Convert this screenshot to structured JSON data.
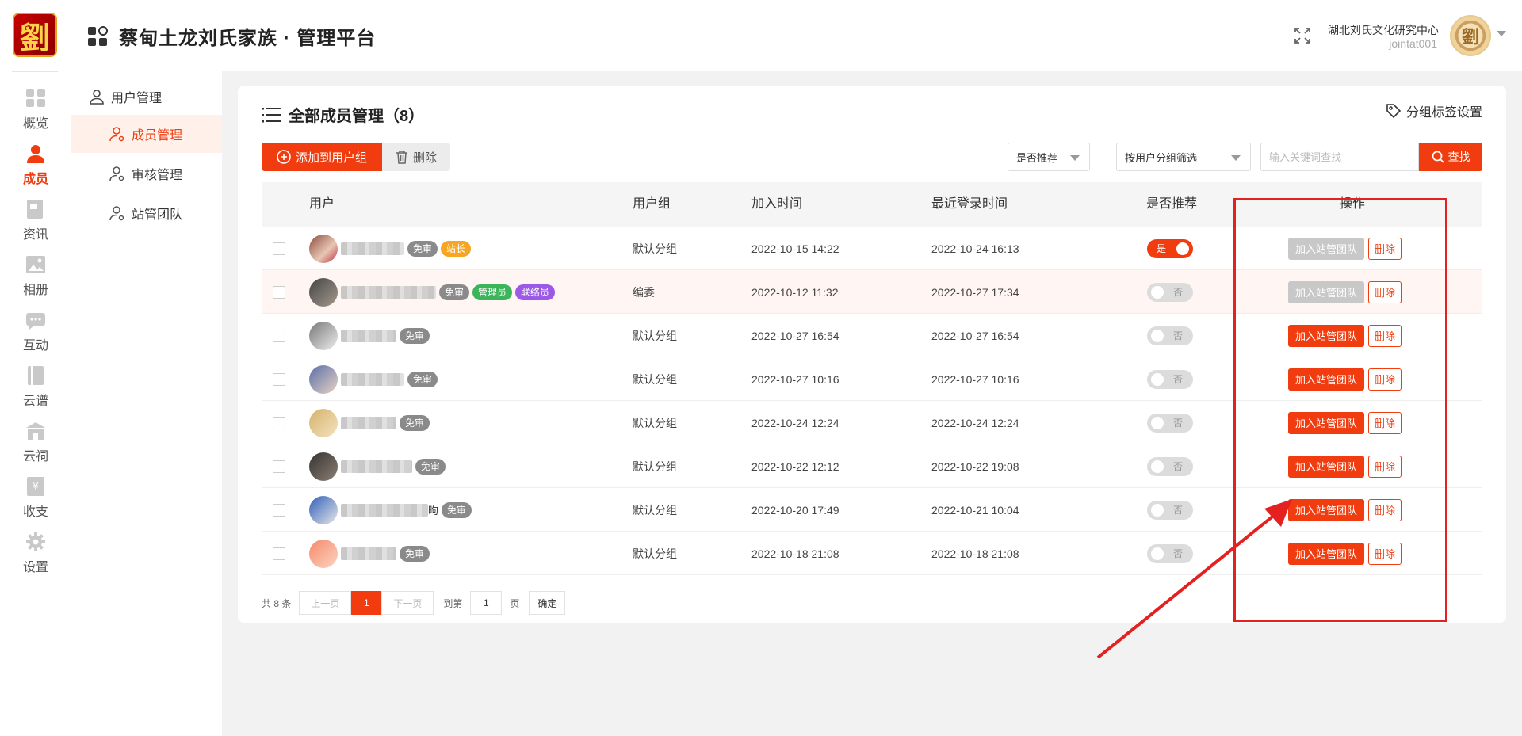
{
  "header": {
    "logo_text": "劉",
    "title": "蔡甸土龙刘氏家族 · 管理平台",
    "org_name": "湖北刘氏文化研究中心",
    "user_id": "jointat001",
    "avatar_text": "劉"
  },
  "rail": {
    "items": [
      {
        "label": "概览",
        "icon": "grid-icon"
      },
      {
        "label": "成员",
        "icon": "person-icon",
        "active": true
      },
      {
        "label": "资讯",
        "icon": "news-icon"
      },
      {
        "label": "相册",
        "icon": "photo-icon"
      },
      {
        "label": "互动",
        "icon": "chat-icon"
      },
      {
        "label": "云谱",
        "icon": "book-icon"
      },
      {
        "label": "云祠",
        "icon": "temple-icon"
      },
      {
        "label": "收支",
        "icon": "ledger-icon"
      },
      {
        "label": "设置",
        "icon": "gear-icon"
      }
    ]
  },
  "submenu": {
    "group": "用户管理",
    "items": [
      {
        "label": "成员管理",
        "active": true
      },
      {
        "label": "审核管理"
      },
      {
        "label": "站管团队"
      }
    ]
  },
  "main": {
    "title": "全部成员管理（8）",
    "tag_setting": "分组标签设置",
    "add_button": "添加到用户组",
    "delete_button": "删除",
    "filter_recommend": "是否推荐",
    "filter_group": "按用户分组筛选",
    "search_placeholder": "输入关键词查找",
    "search_button": "查找",
    "columns": [
      "用户",
      "用户组",
      "加入时间",
      "最近登录时间",
      "是否推荐",
      "操作"
    ],
    "rows": [
      {
        "group": "默认分组",
        "join": "2022-10-15 14:22",
        "login": "2022-10-24 16:13",
        "rec": "是",
        "rec_on": true,
        "badges": [
          "免审",
          "站长"
        ],
        "join_btn": "加入站管团队",
        "join_enabled": false,
        "remove": "删除",
        "name_suffix": ""
      },
      {
        "group": "编委",
        "join": "2022-10-12 11:32",
        "login": "2022-10-27 17:34",
        "rec": "否",
        "rec_on": false,
        "badges": [
          "免审",
          "管理员",
          "联络员"
        ],
        "join_btn": "加入站管团队",
        "join_enabled": false,
        "remove": "删除",
        "name_suffix": ""
      },
      {
        "group": "默认分组",
        "join": "2022-10-27 16:54",
        "login": "2022-10-27 16:54",
        "rec": "否",
        "rec_on": false,
        "badges": [
          "免审"
        ],
        "join_btn": "加入站管团队",
        "join_enabled": true,
        "remove": "删除",
        "name_suffix": ""
      },
      {
        "group": "默认分组",
        "join": "2022-10-27 10:16",
        "login": "2022-10-27 10:16",
        "rec": "否",
        "rec_on": false,
        "badges": [
          "免审"
        ],
        "join_btn": "加入站管团队",
        "join_enabled": true,
        "remove": "删除",
        "name_suffix": ""
      },
      {
        "group": "默认分组",
        "join": "2022-10-24 12:24",
        "login": "2022-10-24 12:24",
        "rec": "否",
        "rec_on": false,
        "badges": [
          "免审"
        ],
        "join_btn": "加入站管团队",
        "join_enabled": true,
        "remove": "删除",
        "name_suffix": ""
      },
      {
        "group": "默认分组",
        "join": "2022-10-22 12:12",
        "login": "2022-10-22 19:08",
        "rec": "否",
        "rec_on": false,
        "badges": [
          "免审"
        ],
        "join_btn": "加入站管团队",
        "join_enabled": true,
        "remove": "删除",
        "name_suffix": ""
      },
      {
        "group": "默认分组",
        "join": "2022-10-20 17:49",
        "login": "2022-10-21 10:04",
        "rec": "否",
        "rec_on": false,
        "badges": [
          "免审"
        ],
        "join_btn": "加入站管团队",
        "join_enabled": true,
        "remove": "删除",
        "name_suffix": "昫"
      },
      {
        "group": "默认分组",
        "join": "2022-10-18 21:08",
        "login": "2022-10-18 21:08",
        "rec": "否",
        "rec_on": false,
        "badges": [
          "免审"
        ],
        "join_btn": "加入站管团队",
        "join_enabled": true,
        "remove": "删除",
        "name_suffix": ""
      }
    ]
  },
  "pager": {
    "total": "共 8 条",
    "prev": "上一页",
    "current": "1",
    "next": "下一页",
    "goto": "到第",
    "page_input": "1",
    "page_unit": "页",
    "confirm": "确定"
  },
  "colors": {
    "accent": "#f03c0f",
    "annotation": "#e52020"
  }
}
